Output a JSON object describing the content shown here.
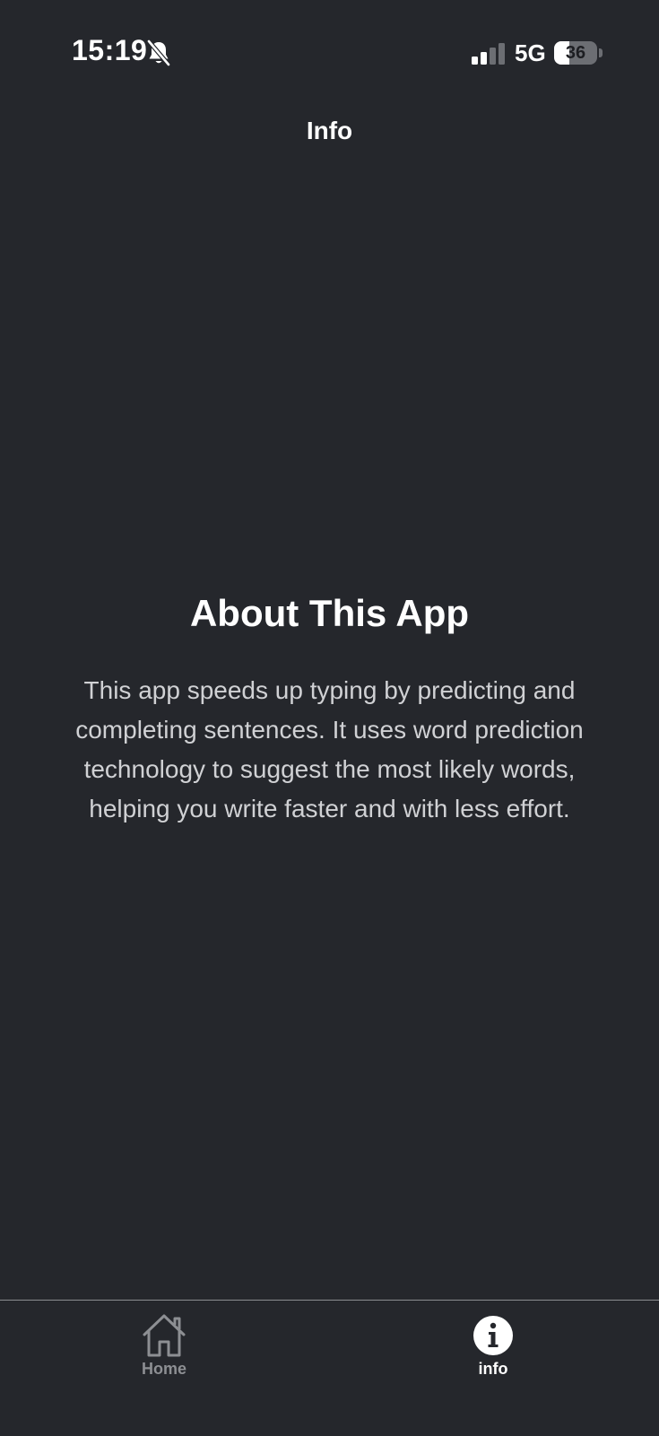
{
  "status_bar": {
    "time": "15:19",
    "network": "5G",
    "battery_level": "36",
    "battery_fraction": 0.36,
    "icons": [
      "bell-slash-icon",
      "signal-icon",
      "battery-icon"
    ]
  },
  "nav": {
    "title": "Info"
  },
  "about": {
    "title": "About This App",
    "body": "This app speeds up typing by predicting and completing sentences. It uses word prediction technology to suggest the most likely words, helping you write faster and with less effort."
  },
  "tab_bar": {
    "items": [
      {
        "label": "Home",
        "icon": "home-icon",
        "active": false
      },
      {
        "label": "info",
        "icon": "info-icon",
        "active": true
      }
    ]
  },
  "colors": {
    "background": "#25272c",
    "text_primary": "#ffffff",
    "text_secondary": "#d0d1d4",
    "tab_inactive": "#8d8f93"
  }
}
